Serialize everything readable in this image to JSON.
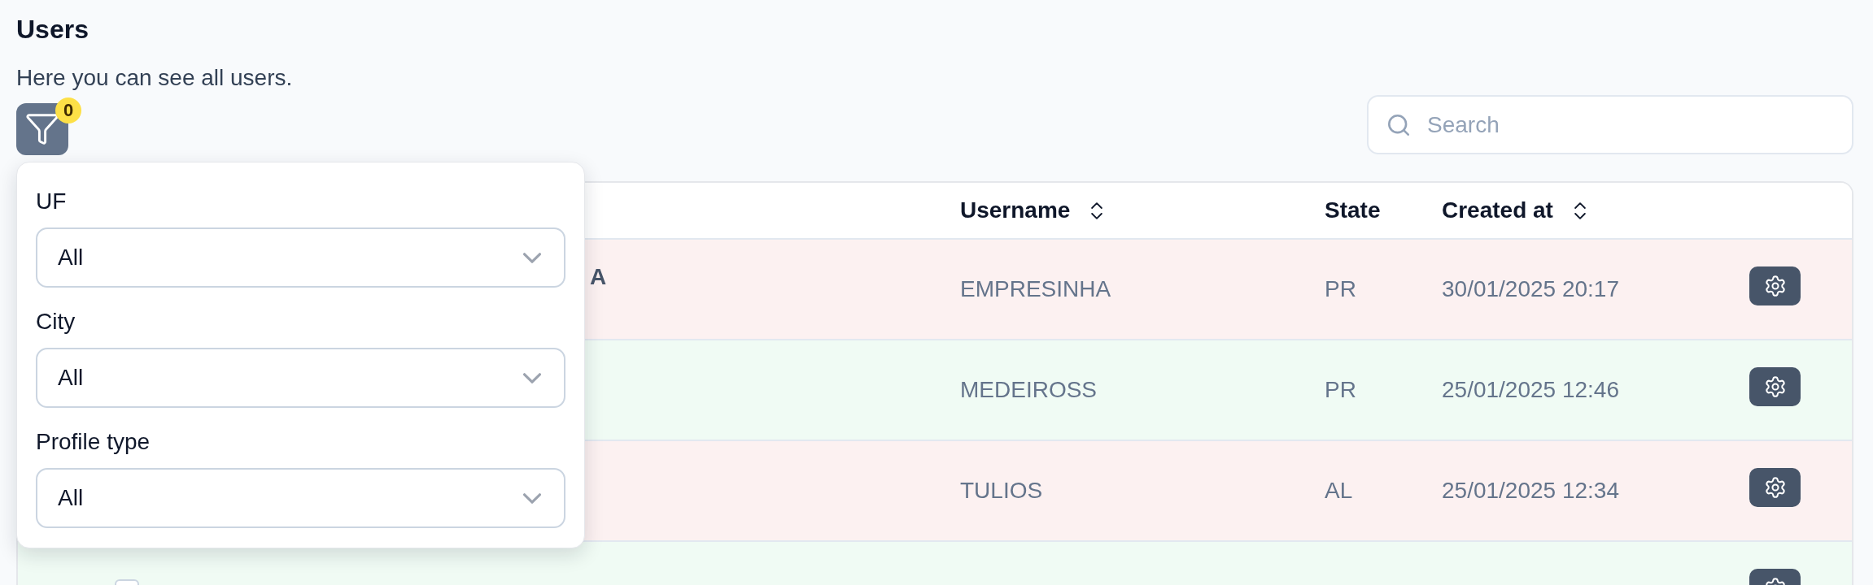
{
  "page": {
    "title": "Users",
    "description": "Here you can see all users."
  },
  "filter_button": {
    "badge": "0",
    "expanded": true
  },
  "search": {
    "placeholder": "Search"
  },
  "filter_panel": {
    "fields": [
      {
        "label": "UF",
        "value": "All"
      },
      {
        "label": "City",
        "value": "All"
      },
      {
        "label": "Profile type",
        "value": "All"
      }
    ]
  },
  "table": {
    "columns": [
      {
        "label": "Username",
        "sortable": true
      },
      {
        "label": "State",
        "sortable": false
      },
      {
        "label": "Created at",
        "sortable": true
      }
    ],
    "rows": [
      {
        "column_1": "A",
        "username": "EMPRESINHA",
        "state": "PR",
        "created_at": "30/01/2025 20:17",
        "color": "#fcf1f1"
      },
      {
        "username": "MEDEIROSS",
        "state": "PR",
        "created_at": "25/01/2025 12:46",
        "color": "#f0fbf4"
      },
      {
        "username": "TULIOS",
        "state": "AL",
        "created_at": "25/01/2025 12:34",
        "color": "#fcf1f1"
      },
      {
        "color": "#f0fbf4",
        "checkbox": true
      }
    ]
  }
}
